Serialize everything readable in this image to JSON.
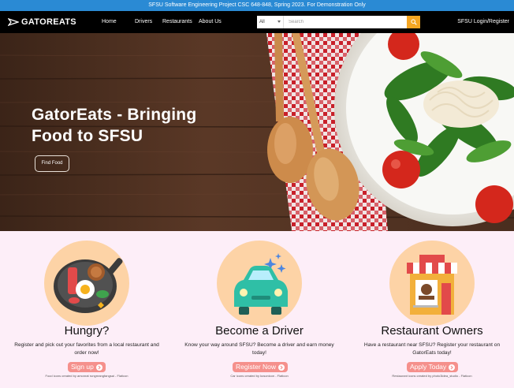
{
  "banner": {
    "text": "SFSU Software Engineering Project CSC 648-848, Spring 2023. For Demonstration Only"
  },
  "nav": {
    "logo": "GATOREATS",
    "links": [
      "Home",
      "Drivers",
      "Restaurants",
      "About Us"
    ],
    "search": {
      "category": "All",
      "placeholder": "Search"
    },
    "login": "SFSU Login/Register"
  },
  "hero": {
    "title": "GatorEats - Bringing Food to SFSU",
    "button": "Find Food"
  },
  "features": [
    {
      "title": "Hungry?",
      "description": "Register and pick out your favorites from a local restaurant and order now!",
      "button": "Sign up",
      "credit": "Food icons created by amonrat rungreangfangsai - Flaticon"
    },
    {
      "title": "Become a Driver",
      "description": "Know your way around SFSU? Become a driver and earn money today!",
      "button": "Register Now",
      "credit": "Car icons created by kosonicon - Flaticon"
    },
    {
      "title": "Restaurant Owners",
      "description": "Have a restaurant near SFSU? Register your restaurant on GatorEats today!",
      "button": "Apply Today",
      "credit": "Restaurant icons created by photo3idea_studio - Flaticon"
    }
  ],
  "colors": {
    "banner": "#2a8ad4",
    "nav": "#000000",
    "search_button": "#f5a623",
    "features_bg": "#fdeef8",
    "icon_circle": "#fdd3a6",
    "cta_button": "#f5908c"
  },
  "icons": [
    "logo-icon",
    "search-icon",
    "chevron-down-icon",
    "food-icon",
    "car-icon",
    "restaurant-icon",
    "arrow-right-icon"
  ]
}
